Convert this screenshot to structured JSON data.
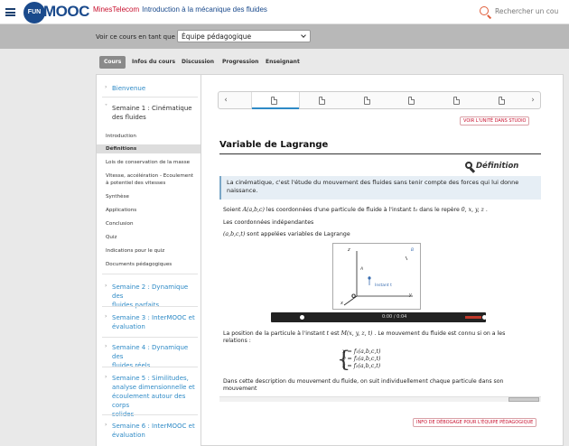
{
  "header": {
    "brand_left": "FUN",
    "brand_main": "MOOC",
    "brand_org": "MinesTelecom",
    "course_title": "Introduction à la mécanique des fluides",
    "search_placeholder": "Rechercher un cou"
  },
  "rolebar": {
    "label": "Voir ce cours en tant que :",
    "selected": "Équipe pédagogique"
  },
  "tabs": [
    "Cours",
    "Infos du cours",
    "Discussion",
    "Progression",
    "Enseignant"
  ],
  "sidebar": {
    "bienvenue": "Bienvenue",
    "week1": [
      "Semaine 1 : Cinématique",
      "des fluides"
    ],
    "week1_items": [
      "Introduction",
      "Définitions",
      "Lois de conservation de la masse",
      "Vitesse, accélération - Ecoulement",
      "à potentiel des vitesses",
      "Synthèse",
      "Applications",
      "Conclusion",
      "Quiz",
      "Indications pour le quiz",
      "Documents pédagogiques"
    ],
    "week2": [
      "Semaine 2 : Dynamique des",
      "fluides parfaits"
    ],
    "week3": [
      "Semaine 3 : InterMOOC et",
      "évaluation"
    ],
    "week4": [
      "Semaine 4 : Dynamique des",
      "fluides réels"
    ],
    "week5": [
      "Semaine 5 : Similitudes,",
      "analyse dimensionnelle et",
      "écoulement autour des corps",
      "solides"
    ],
    "week6": [
      "Semaine 6 : InterMOOC et",
      "évaluation"
    ]
  },
  "content": {
    "view_studio": "VOIR L'UNITÉ DANS STUDIO",
    "unit_title": "Variable de Lagrange",
    "definition_heading": "Définition",
    "definition_text": [
      "La cinématique, c'est l'étude du mouvement des fluides sans tenir compte des forces qui lui donne",
      "naissance."
    ],
    "p1_a": "Soient ",
    "p1_m1": "A(a,b,c)",
    "p1_b": " les coordonnées d'une particule de fluide à l'instant ",
    "p1_m2": "t₀",
    "p1_c": " dans le repère ",
    "p1_m3": "0, x, y, z",
    "p1_d": " .",
    "p2": "Les coordonnées indépendantes",
    "p3_m": "(a,b,c,t)",
    "p3": " sont appelées variables de Lagrange",
    "video_time": "0:00 / 0:04",
    "p4_a": "La position de la particule à l'instant ",
    "p4_m1": "t",
    "p4_b": " est ",
    "p4_m2": "M(x, y, z, t)",
    "p4_c": " . Le mouvement du fluide est connu si on a les",
    "p4_d": "relations :",
    "eq1": "x = f₁(a,b,c,t)",
    "eq2": "y = f₂(a,b,c,t)",
    "eq3": "z = f₃(a,b,c,t)",
    "p5": [
      "Dans cette description du mouvement du fluide, on suit individuellement chaque particule dans son",
      "mouvement"
    ],
    "debug_info": "INFO DE DÉBOGAGE POUR L'ÉQUIPE PÉDAGOGIQUE",
    "figure": {
      "z": "z",
      "x": "x",
      "y": "y",
      "origin": "O",
      "A": "A",
      "B": "B",
      "label": "Instant t"
    }
  }
}
